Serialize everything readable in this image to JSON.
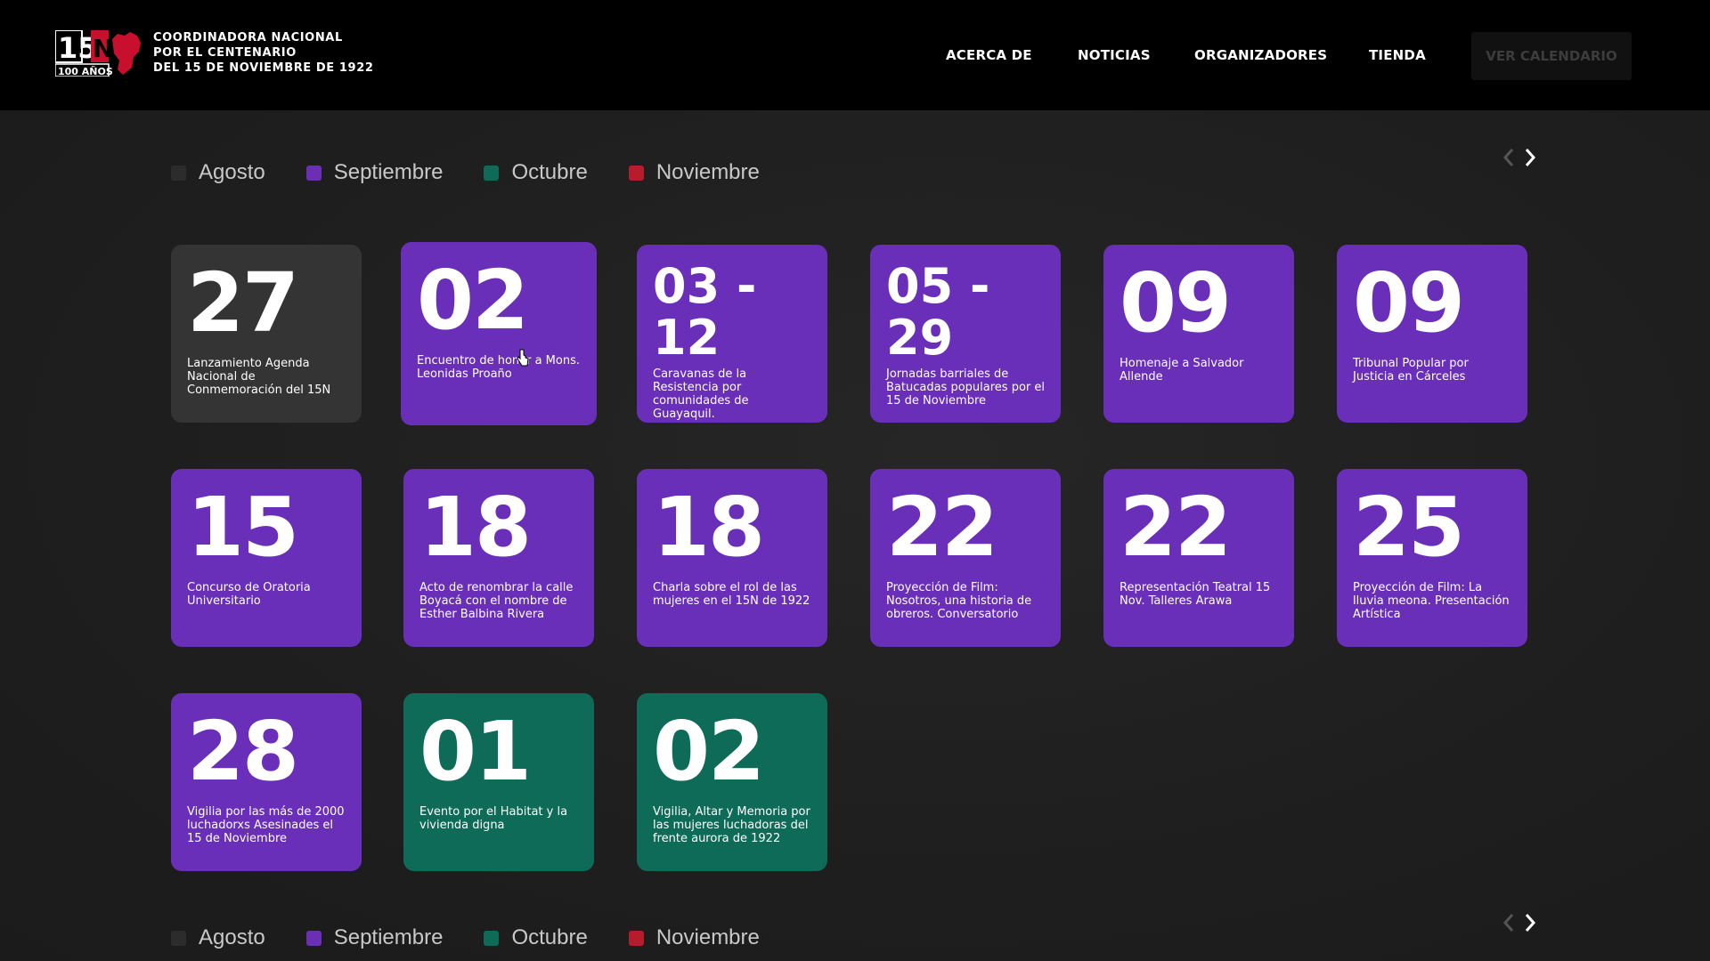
{
  "brand": {
    "logo_text_main": "15N",
    "logo_text_sub": "100 AÑOS",
    "line1": "COORDINADORA NACIONAL",
    "line2": "POR EL CENTENARIO",
    "line3": "DEL 15 DE NOVIEMBRE DE 1922"
  },
  "nav": {
    "about": "ACERCA DE",
    "news": "NOTICIAS",
    "organizers": "ORGANIZADORES",
    "store": "TIENDA",
    "calendar_button": "VER CALENDARIO"
  },
  "legend": [
    {
      "label": "Agosto",
      "color": "#2c2c2c"
    },
    {
      "label": "Septiembre",
      "color": "#6b2fb5"
    },
    {
      "label": "Octubre",
      "color": "#0d6b57"
    },
    {
      "label": "Noviembre",
      "color": "#b71c2c"
    }
  ],
  "colors": {
    "agosto": "#343434",
    "septiembre": "#6a2fb9",
    "octubre": "#0d6b57",
    "noviembre": "#b71c2c"
  },
  "events": [
    {
      "day": "27",
      "desc": "Lanzamiento Agenda Nacional de Conmemoración del 15N"
    },
    {
      "day": "02",
      "desc": "Encuentro de honor a Mons. Leonidas Proaño"
    },
    {
      "day": "03 -\n12",
      "desc": "Caravanas de la Resistencia por comunidades de Guayaquil."
    },
    {
      "day": "05 -\n29",
      "desc": "Jornadas barriales de Batucadas populares por el 15 de Noviembre"
    },
    {
      "day": "09",
      "desc": "Homenaje a Salvador Allende"
    },
    {
      "day": "09",
      "desc": "Tribunal Popular por Justicia en Cárceles"
    },
    {
      "day": "15",
      "desc": "Concurso de Oratoria Universitario"
    },
    {
      "day": "18",
      "desc": "Acto de renombrar la calle Boyacá con el nombre de Esther Balbina Rivera"
    },
    {
      "day": "18",
      "desc": "Charla sobre el rol de las mujeres en el 15N de 1922"
    },
    {
      "day": "22",
      "desc": "Proyección de Film: Nosotros, una historia de obreros. Conversatorio"
    },
    {
      "day": "22",
      "desc": "Representación Teatral 15 Nov. Talleres Arawa"
    },
    {
      "day": "25",
      "desc": "Proyección de Film: La lluvia meona. Presentación Artística"
    },
    {
      "day": "28",
      "desc": "Vigilia por las más de 2000 luchadorxs Asesinades el 15 de Noviembre"
    },
    {
      "day": "01",
      "desc": "Evento por el Habitat y la vivienda digna"
    },
    {
      "day": "02",
      "desc": "Vigilia, Altar y Memoria por las mujeres luchadoras del frente aurora de 1922"
    }
  ]
}
